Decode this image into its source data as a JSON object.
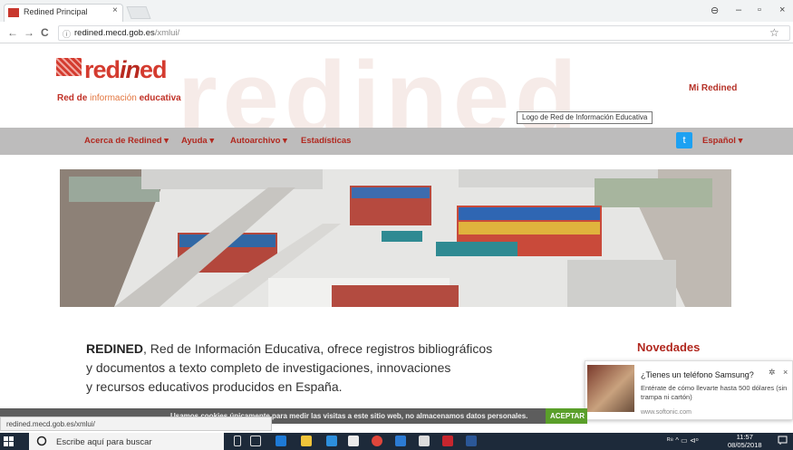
{
  "browser": {
    "tab_title": "Redined Principal",
    "tab_close": "×",
    "url_host": "redined.mecd.gob.es",
    "url_path": "/xmlui/",
    "back": "←",
    "forward": "→",
    "reload": "C",
    "info": "ⓘ",
    "star": "☆",
    "account": "⊖",
    "minimize": "–",
    "maximize": "▫",
    "close": "×",
    "status_url": "redined.mecd.gob.es/xmlui/"
  },
  "header": {
    "logo_word_a": "red",
    "logo_word_b": "in",
    "logo_word_c": "ed",
    "logo_sub_a": "Red de ",
    "logo_sub_b": "información",
    "logo_sub_c": " educativa",
    "watermark": "redined",
    "user_link": "Mi Redined",
    "tooltip": "Logo de Red de Información Educativa"
  },
  "menu": {
    "items": [
      "Acerca de Redined ▾",
      "Ayuda ▾",
      "Autoarchivo ▾",
      "Estadísticas"
    ],
    "language": "Español ▾",
    "twitter": "t"
  },
  "intro": {
    "brand": "REDINED",
    "line1_rest": ", Red de Información Educativa, ofrece registros bibliográficos",
    "line2": "y documentos a texto completo de investigaciones, innovaciones",
    "line3": "y recursos educativos producidos en España."
  },
  "news": {
    "title": "Novedades"
  },
  "ad": {
    "title": "¿Tienes un teléfono Samsung?",
    "body": "Entérate de cómo llevarte hasta 500 dólares (sin trampa ni cartón)",
    "source": "www.softonic.com",
    "gear": "✲",
    "close": "×"
  },
  "cookie": {
    "text": "Usamos cookies únicamente para medir las visitas a este sitio web, no almacenamos datos personales.",
    "accept": "ACEPTAR"
  },
  "taskbar": {
    "search_placeholder": "Escribe aquí para buscar",
    "time": "11:57",
    "date": "08/05/2018",
    "tray": "ᴿ⁸  ^  ▭  ⊲ᵒ"
  },
  "colors": {
    "brand_red": "#c13228",
    "menu_bg": "#bdbcbc",
    "twitter": "#1da1f2",
    "accept_green": "#5a9f2a",
    "taskbar": "#1d2a3a"
  }
}
